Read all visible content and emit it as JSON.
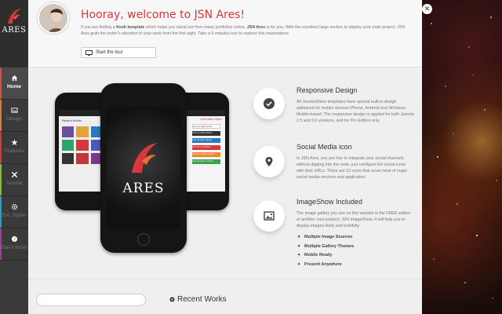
{
  "brand": {
    "logo_text": "ARES"
  },
  "sidebar": {
    "items": [
      {
        "label": "Home",
        "icon": "home-icon",
        "accent": "#e04b3a",
        "active": true
      },
      {
        "label": "Design",
        "icon": "image-icon",
        "accent": "#e07b2a",
        "active": false
      },
      {
        "label": "Features",
        "icon": "star-icon",
        "accent": "#d9383a",
        "active": false
      },
      {
        "label": "Joomla",
        "icon": "joomla-icon",
        "accent": "#8bbd2a",
        "active": false
      },
      {
        "label": "Ext. Styles",
        "icon": "gear-icon",
        "accent": "#27a0c6",
        "active": false
      },
      {
        "label": "Get it Now!",
        "icon": "question-icon",
        "accent": "#9b3fa1",
        "active": false
      }
    ]
  },
  "hero": {
    "title": "Hooray, welcome to JSN Ares!",
    "intro_1": "If you are finding a ",
    "intro_bold_1": "fresh template",
    "intro_2": " which helps you stand out from many portfolios online, ",
    "intro_bold_2": "JSN Ares",
    "intro_3": " is for you. With the excellent large section to display your main project, JSN Ares grab the visiter's attention to your work from the first sight. Take a 5-minutes tour to explore this masterpiece",
    "tour_button": "Start the tour"
  },
  "features": [
    {
      "title": "Responsive Design",
      "icon": "check-icon",
      "text": "All JoomlaShine templates have special built-in design optimized for mobile devices iPhone, Android and Windows Mobile-based. The responsive design is applied for both Joomla 2.5 and 3.0 versions, and for Pro Edition only."
    },
    {
      "title": "Social Media icon",
      "icon": "map-pin-icon",
      "text": "In JSN Ares, you are free to integrate your social channels without digging into the code, just configure the social icons with their URLs. There are 12 icons that cover most of major social media services and application."
    },
    {
      "title": "ImageShow Included",
      "icon": "picture-icon",
      "text": "The image gallery you see on this website is the FREE edition of another cool product: JSN ImageShow. It will help you to display images lively and truthfully"
    }
  ],
  "imageshow_list": [
    "Multiple Image Sources",
    "Multiple Gallery Themes",
    "Mobile Ready",
    "Present Anywhere"
  ],
  "phones": {
    "left_header": "Recent Works",
    "right_header": "Link Button Styles",
    "right_buttons": [
      "Link as light button",
      "Link as dark button",
      "Link as blue button",
      "Link as red button",
      "Link as orange button",
      "Link as green button"
    ],
    "center_text": "ARES"
  },
  "bottom": {
    "recent_title": "Recent Works"
  },
  "close_label": "✕"
}
